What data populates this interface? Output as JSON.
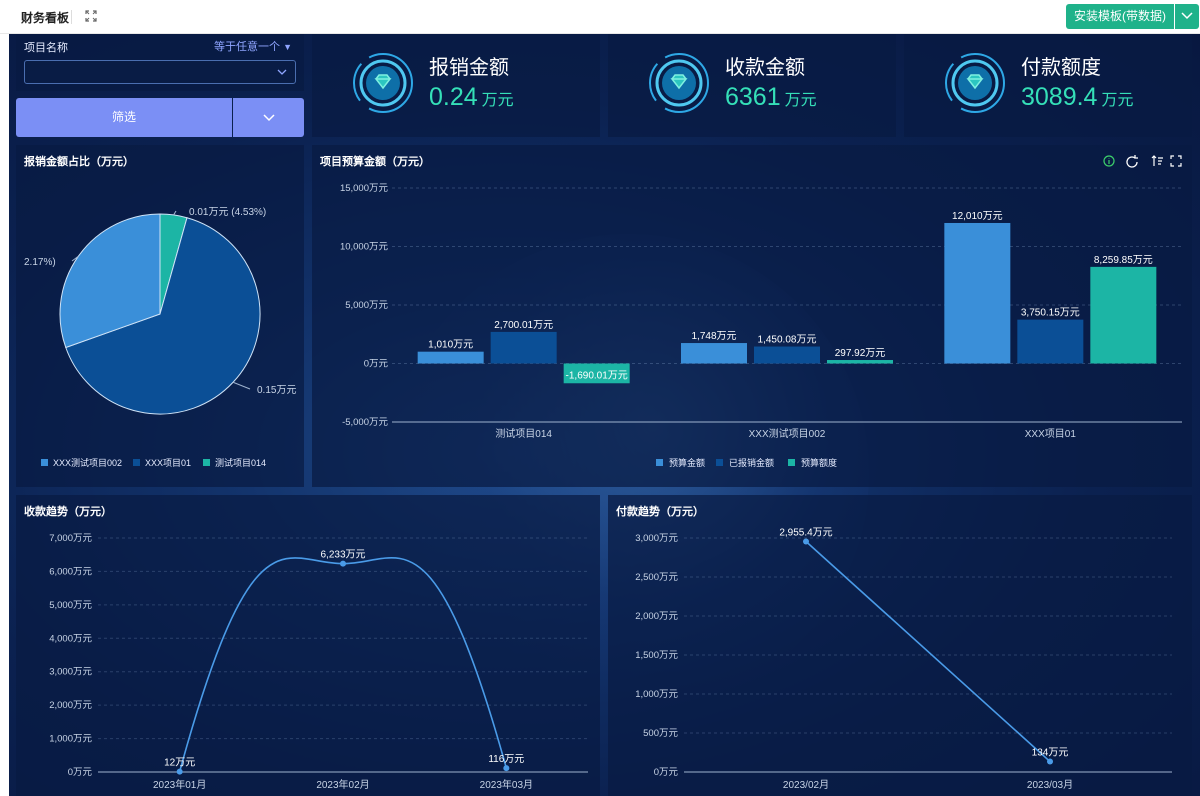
{
  "header": {
    "title": "财务看板",
    "install_label": "安装模板(带数据)"
  },
  "filter": {
    "label": "项目名称",
    "operator": "等于任意一个",
    "button": "筛选"
  },
  "kpis": [
    {
      "label": "报销金额",
      "value": "0.24",
      "unit": "万元"
    },
    {
      "label": "收款金额",
      "value": "6361",
      "unit": "万元"
    },
    {
      "label": "付款额度",
      "value": "3089.4",
      "unit": "万元"
    }
  ],
  "colors": {
    "accent": "#35e0b8",
    "series1": "#3a8fd9",
    "series2": "#0b4f96",
    "series3": "#1cb5a5",
    "line": "#4a9be8"
  },
  "chart_data": [
    {
      "type": "pie",
      "title": "报销金额占比（万元）",
      "slices": [
        {
          "name": "XXX测试项目002",
          "label": "2.17%)",
          "value": 0.07,
          "color": "#3a8fd9"
        },
        {
          "name": "XXX项目01",
          "label": "0.15万元",
          "value": 0.15,
          "color": "#0b4f96"
        },
        {
          "name": "测试项目014",
          "label": "0.01万元 (4.53%)",
          "value": 0.01,
          "color": "#1cb5a5"
        }
      ],
      "legend_position": "bottom"
    },
    {
      "type": "bar",
      "title": "项目预算金额（万元）",
      "categories": [
        "测试项目014",
        "XXX测试项目002",
        "XXX项目01"
      ],
      "series": [
        {
          "name": "预算金额",
          "values": [
            1010,
            1748,
            12010
          ],
          "labels": [
            "1,010万元",
            "1,748万元",
            "12,010万元"
          ],
          "color": "#3a8fd9"
        },
        {
          "name": "已报销金额",
          "values": [
            2700.01,
            1450.08,
            3750.15
          ],
          "labels": [
            "2,700.01万元",
            "1,450.08万元",
            "3,750.15万元"
          ],
          "color": "#0b4f96"
        },
        {
          "name": "预算额度",
          "values": [
            -1690.01,
            297.92,
            8259.85
          ],
          "labels": [
            "-1,690.01万元",
            "297.92万元",
            "8,259.85万元"
          ],
          "color": "#1cb5a5"
        }
      ],
      "yticks": [
        "15,000万元",
        "10,000万元",
        "5,000万元",
        "0万元",
        "-5,000万元"
      ],
      "ylim": [
        -5000,
        15000
      ],
      "legend_position": "bottom"
    },
    {
      "type": "line",
      "title": "收款趋势（万元）",
      "categories": [
        "2023年01月",
        "2023年02月",
        "2023年03月"
      ],
      "values": [
        12,
        6233,
        116
      ],
      "labels": [
        "12万元",
        "6,233万元",
        "116万元"
      ],
      "yticks": [
        "7,000万元",
        "6,000万元",
        "5,000万元",
        "4,000万元",
        "3,000万元",
        "2,000万元",
        "1,000万元",
        "0万元"
      ],
      "ylim": [
        0,
        7000
      ]
    },
    {
      "type": "line",
      "title": "付款趋势（万元）",
      "categories": [
        "2023/02月",
        "2023/03月"
      ],
      "values": [
        2955.4,
        134
      ],
      "labels": [
        "2,955.4万元",
        "134万元"
      ],
      "yticks": [
        "3,000万元",
        "2,500万元",
        "2,000万元",
        "1,500万元",
        "1,000万元",
        "500万元",
        "0万元"
      ],
      "ylim": [
        0,
        3000
      ]
    }
  ]
}
